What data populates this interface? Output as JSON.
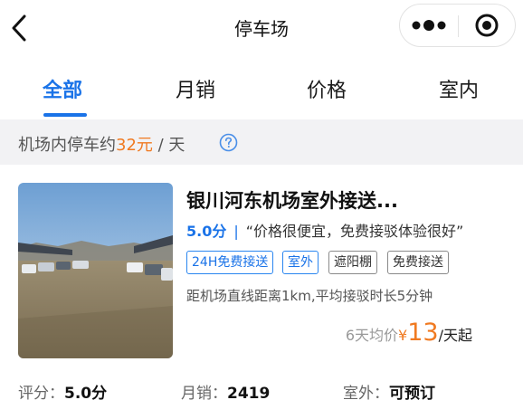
{
  "navbar": {
    "title": "停车场",
    "back_icon": "chevron-left-icon",
    "more_icon": "more-dots-icon",
    "close_icon": "target-close-icon"
  },
  "tabs": [
    {
      "label": "全部",
      "active": true
    },
    {
      "label": "月销",
      "active": false
    },
    {
      "label": "价格",
      "active": false
    },
    {
      "label": "室内",
      "active": false
    }
  ],
  "info": {
    "prefix": "机场内停车约",
    "price": "32元",
    "suffix": " / 天",
    "help_icon": "question-circle-icon"
  },
  "lot": {
    "title": "银川河东机场室外接送...",
    "score": "5.0分",
    "separator": "|",
    "review": "“价格很便宜，免费接驳体验很好”",
    "tags": [
      {
        "label": "24H免费接送",
        "style": "blue"
      },
      {
        "label": "室外",
        "style": "blue"
      },
      {
        "label": "遮阳棚",
        "style": "gray"
      },
      {
        "label": "免费接送",
        "style": "gray"
      }
    ],
    "distance": "距机场直线距离1km,平均接驳时长5分钟",
    "price_prefix": "6天均价",
    "price_currency": "¥",
    "price_value": "13",
    "price_unit": "/天起",
    "stats": [
      {
        "label": "评分：",
        "value": "5.0分"
      },
      {
        "label": "月销：",
        "value": "2419"
      },
      {
        "label": "室外：",
        "value": "可预订"
      }
    ]
  },
  "colors": {
    "accent": "#1a73e8",
    "price": "#f07a21",
    "infobar_bg": "#f2f2f4"
  }
}
